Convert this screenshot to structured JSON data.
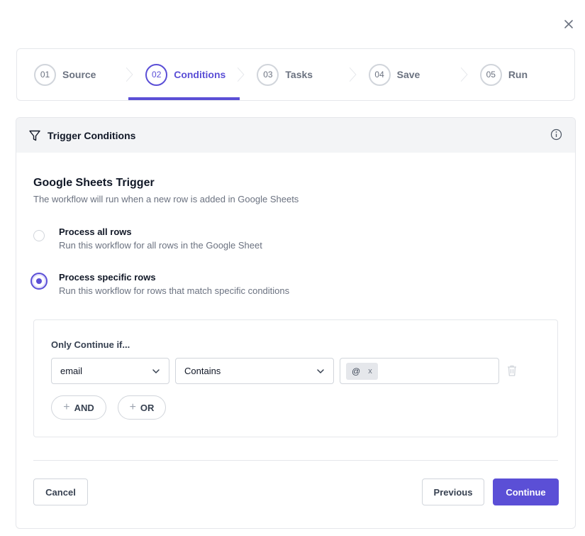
{
  "stepper": {
    "steps": [
      {
        "num": "01",
        "label": "Source"
      },
      {
        "num": "02",
        "label": "Conditions"
      },
      {
        "num": "03",
        "label": "Tasks"
      },
      {
        "num": "04",
        "label": "Save"
      },
      {
        "num": "05",
        "label": "Run"
      }
    ],
    "active_step": "02"
  },
  "panel": {
    "header_title": "Trigger Conditions",
    "section_title": "Google Sheets Trigger",
    "section_subtitle": "The workflow will run when a new row is added in Google Sheets",
    "options": [
      {
        "label": "Process all rows",
        "description": "Run this workflow for all rows in the Google Sheet",
        "selected": false
      },
      {
        "label": "Process specific rows",
        "description": "Run this workflow for rows that match specific conditions",
        "selected": true
      }
    ],
    "condition": {
      "title": "Only Continue if...",
      "field": "email",
      "operator": "Contains",
      "value_tag": "@",
      "tag_remove": "x",
      "and_label": "AND",
      "or_label": "OR",
      "plus_glyph": "+"
    }
  },
  "footer": {
    "cancel_label": "Cancel",
    "previous_label": "Previous",
    "continue_label": "Continue"
  },
  "colors": {
    "accent": "#5b4fd6",
    "header_bg": "#f3f4f6",
    "border": "#e5e7eb"
  },
  "icons": {
    "close": "close-icon",
    "filter": "filter-icon",
    "info": "info-icon",
    "chevron": "chevron-down-icon",
    "trash": "trash-icon"
  }
}
